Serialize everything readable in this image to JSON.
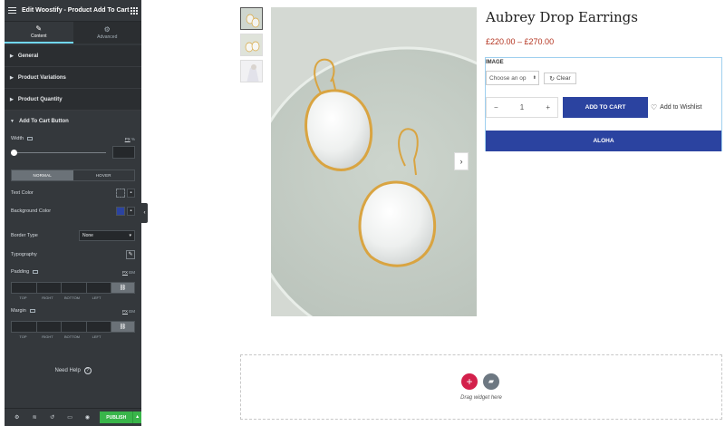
{
  "panel": {
    "title": "Edit Woostify - Product Add To Cart",
    "tabs": [
      {
        "label": "Content",
        "icon": "pencil-icon",
        "active": true
      },
      {
        "label": "Advanced",
        "icon": "gear-icon",
        "active": false
      }
    ],
    "sections": [
      {
        "label": "General",
        "open": false
      },
      {
        "label": "Product Variations",
        "open": false
      },
      {
        "label": "Product Quantity",
        "open": false
      },
      {
        "label": "Add To Cart Button",
        "open": true
      }
    ],
    "width": {
      "label": "Width",
      "unit_px": "PX",
      "unit_pct": "%",
      "value": ""
    },
    "state_toggle": {
      "normal": "NORMAL",
      "hover": "HOVER",
      "active": "normal"
    },
    "text_color": {
      "label": "Text Color"
    },
    "background_color": {
      "label": "Background Color",
      "value": "#2b43a0"
    },
    "border_type": {
      "label": "Border Type",
      "value": "None"
    },
    "typography": {
      "label": "Typography"
    },
    "padding": {
      "label": "Padding",
      "unit_px": "PX",
      "unit_em": "EM",
      "labels": [
        "TOP",
        "RIGHT",
        "BOTTOM",
        "LEFT"
      ]
    },
    "margin": {
      "label": "Margin",
      "unit_px": "PX",
      "unit_em": "EM",
      "labels": [
        "TOP",
        "RIGHT",
        "BOTTOM",
        "LEFT"
      ]
    },
    "need_help": "Need Help",
    "footer": {
      "publish": "PUBLISH"
    }
  },
  "product": {
    "title": "Aubrey Drop Earrings",
    "price": "£220.00 – £270.00",
    "image_label": "IMAGE",
    "variation_placeholder": "Choose an op",
    "clear_label": "Clear",
    "quantity": "1",
    "qty_minus": "−",
    "qty_plus": "+",
    "add_to_cart": "ADD TO CART",
    "wishlist": "Add to Wishlist",
    "aloha": "ALOHA"
  },
  "drop_zone": {
    "text": "Drag widget here"
  },
  "colors": {
    "accent": "#2b43a0",
    "publish": "#39b54a",
    "add_widget": "#d3204b",
    "price": "#b3321e"
  }
}
